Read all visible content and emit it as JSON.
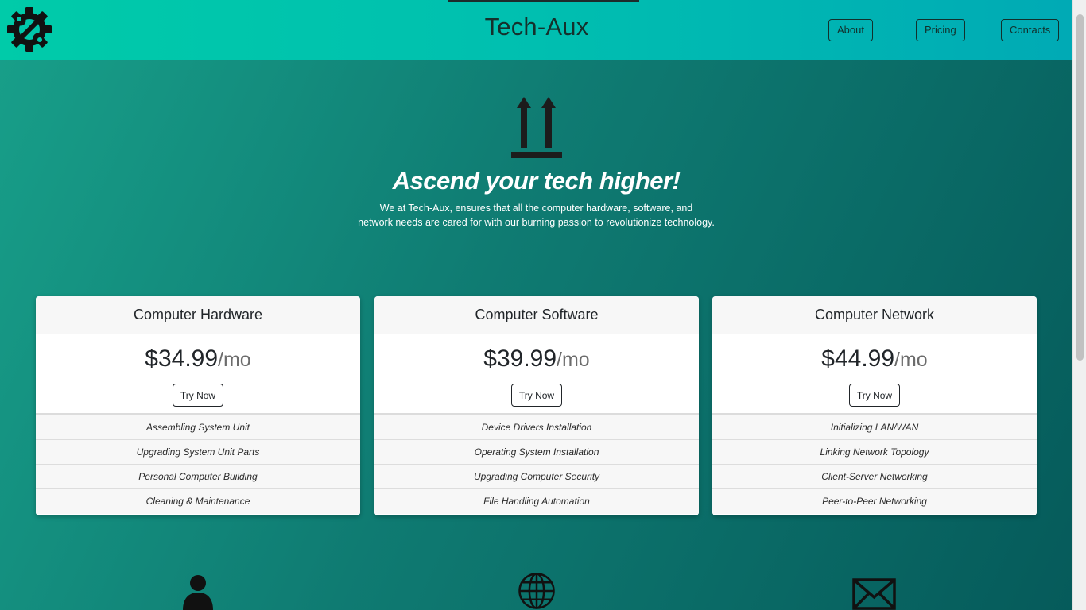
{
  "header": {
    "brand": "Tech-Aux",
    "nav": {
      "about": "About",
      "pricing": "Pricing",
      "contacts": "Contacts"
    }
  },
  "hero": {
    "title": "Ascend your tech higher!",
    "line1": "We at Tech-Aux, ensures that all the computer hardware, software, and",
    "line2": "network needs are cared for with our burning passion to revolutionize technology."
  },
  "plans": [
    {
      "name": "Computer Hardware",
      "price": "$34.99",
      "unit": "/mo",
      "button": "Try Now",
      "features": [
        "Assembling System Unit",
        "Upgrading System Unit Parts",
        "Personal Computer Building",
        "Cleaning & Maintenance"
      ]
    },
    {
      "name": "Computer Software",
      "price": "$39.99",
      "unit": "/mo",
      "button": "Try Now",
      "features": [
        "Device Drivers Installation",
        "Operating System Installation",
        "Upgrading Computer Security",
        "File Handling Automation"
      ]
    },
    {
      "name": "Computer Network",
      "price": "$44.99",
      "unit": "/mo",
      "button": "Try Now",
      "features": [
        "Initializing LAN/WAN",
        "Linking Network Topology",
        "Client-Server Networking",
        "Peer-to-Peer Networking"
      ]
    }
  ],
  "icons": {
    "logo": "gear-wrench-icon",
    "hero": "arrows-up-icon",
    "bottom": [
      "person-icon",
      "globe-icon",
      "envelope-icon"
    ]
  },
  "colors": {
    "header_start": "#00cba9",
    "header_end": "#00aab5",
    "background_start": "#18a08a",
    "background_end": "#055a5a"
  }
}
